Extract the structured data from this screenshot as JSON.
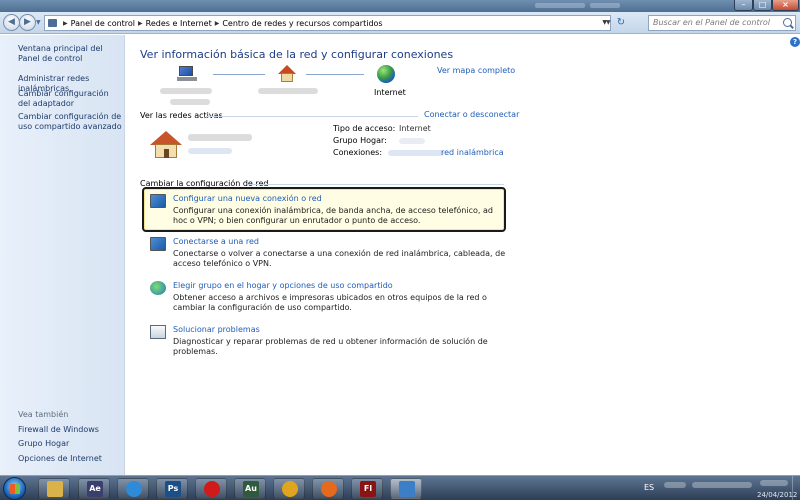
{
  "address": {
    "crumbs": [
      "Panel de control",
      "Redes e Internet",
      "Centro de redes y recursos compartidos"
    ],
    "search_placeholder": "Buscar en el Panel de control"
  },
  "sidebar": {
    "items": [
      "Ventana principal del Panel de control",
      "Administrar redes inalámbricas",
      "Cambiar configuración del adaptador",
      "Cambiar configuración de uso compartido avanzado"
    ],
    "see_also_heading": "Vea también",
    "see_also": [
      "Firewall de Windows",
      "Grupo Hogar",
      "Opciones de Internet"
    ]
  },
  "main": {
    "title": "Ver información básica de la red y configurar conexiones",
    "map_link": "Ver mapa completo",
    "internet_label": "Internet",
    "active_networks_label": "Ver las redes activas",
    "connect_link": "Conectar o desconectar",
    "details": {
      "access_type_label": "Tipo de acceso:",
      "access_type_value": "Internet",
      "homegroup_label": "Grupo Hogar:",
      "connections_label": "Conexiones:",
      "connection_link": "red inalámbrica"
    },
    "change_settings_label": "Cambiar la configuración de red",
    "tasks": [
      {
        "title": "Configurar una nueva conexión o red",
        "desc": "Configurar una conexión inalámbrica, de banda ancha, de acceso telefónico, ad hoc o VPN; o bien configurar un enrutador o punto de acceso."
      },
      {
        "title": "Conectarse a una red",
        "desc": "Conectarse o volver a conectarse a una conexión de red inalámbrica, cableada, de acceso telefónico o VPN."
      },
      {
        "title": "Elegir grupo en el hogar y opciones de uso compartido",
        "desc": "Obtener acceso a archivos e impresoras ubicados en otros equipos de la red o cambiar la configuración de uso compartido."
      },
      {
        "title": "Solucionar problemas",
        "desc": "Diagnosticar y reparar problemas de red u obtener información de solución de problemas."
      }
    ]
  },
  "taskbar": {
    "apps": [
      {
        "icon": "file-explorer-icon",
        "label": "",
        "color": "#d9b24a"
      },
      {
        "icon": "after-effects-icon",
        "label": "Ae",
        "color": "#3a3f6e"
      },
      {
        "icon": "app-circle-icon",
        "label": "",
        "color": "#2f8ad8"
      },
      {
        "icon": "photoshop-icon",
        "label": "Ps",
        "color": "#1b4f8a"
      },
      {
        "icon": "record-icon",
        "label": "",
        "color": "#d11a1a"
      },
      {
        "icon": "audition-icon",
        "label": "Au",
        "color": "#2f5a3c"
      },
      {
        "icon": "chrome-icon",
        "label": "",
        "color": "#e0a51e"
      },
      {
        "icon": "media-player-icon",
        "label": "",
        "color": "#e56a1c"
      },
      {
        "icon": "flash-icon",
        "label": "Fl",
        "color": "#8a1313"
      },
      {
        "icon": "network-center-icon",
        "label": "",
        "color": "#3c7fc6"
      }
    ],
    "lang": "ES",
    "date": "24/04/2012"
  }
}
